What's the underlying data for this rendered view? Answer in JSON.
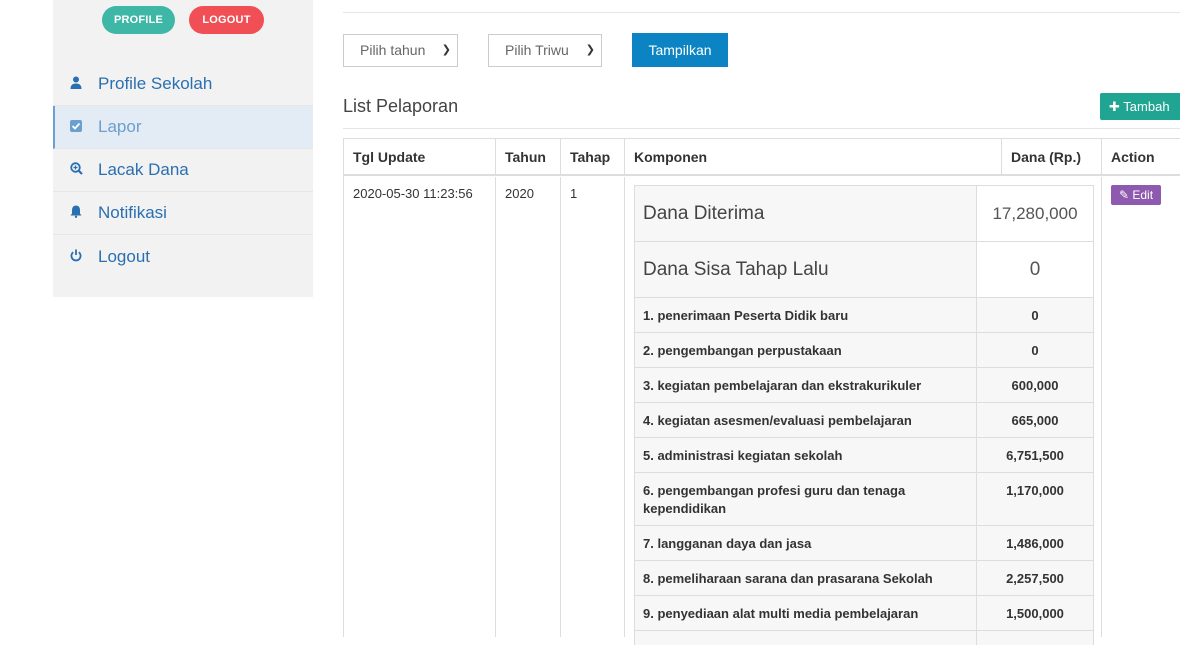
{
  "sidebar": {
    "profile_btn": "PROFILE",
    "logout_btn": "LOGOUT",
    "items": [
      {
        "label": "Profile Sekolah",
        "icon": "user-icon"
      },
      {
        "label": "Lapor",
        "icon": "check-square-icon"
      },
      {
        "label": "Lacak Dana",
        "icon": "search-plus-icon"
      },
      {
        "label": "Notifikasi",
        "icon": "bell-icon"
      },
      {
        "label": "Logout",
        "icon": "power-icon"
      }
    ]
  },
  "filters": {
    "year_select": "Pilih tahun",
    "quarter_select": "Pilih Triwu",
    "show_button": "Tampilkan"
  },
  "list": {
    "title": "List Pelaporan",
    "add_button": "Tambah"
  },
  "table": {
    "headers": [
      "Tgl Update",
      "Tahun",
      "Tahap",
      "Komponen",
      "Dana (Rp.)",
      "Action"
    ],
    "row": {
      "tgl_update": "2020-05-30 11:23:56",
      "tahun": "2020",
      "tahap": "1",
      "edit_button": "Edit",
      "komponen": [
        {
          "label": "Dana Diterima",
          "value": "17,280,000"
        },
        {
          "label": "Dana Sisa Tahap Lalu",
          "value": "0"
        },
        {
          "label": "1. penerimaan Peserta Didik baru",
          "value": "0"
        },
        {
          "label": "2. pengembangan perpustakaan",
          "value": "0"
        },
        {
          "label": "3. kegiatan pembelajaran dan ekstrakurikuler",
          "value": "600,000"
        },
        {
          "label": "4. kegiatan asesmen/evaluasi pembelajaran",
          "value": "665,000"
        },
        {
          "label": "5. administrasi kegiatan sekolah",
          "value": "6,751,500"
        },
        {
          "label": "6. pengembangan profesi guru dan tenaga kependidikan",
          "value": "1,170,000"
        },
        {
          "label": "7. langganan daya dan jasa",
          "value": "1,486,000"
        },
        {
          "label": "8. pemeliharaan sarana dan prasarana Sekolah",
          "value": "2,257,500"
        },
        {
          "label": "9. penyediaan alat multi media pembelajaran",
          "value": "1,500,000"
        }
      ]
    }
  },
  "colors": {
    "profile": "#3fb7a6",
    "logout": "#f05055",
    "primary": "#0c84c4",
    "add": "#1fa592",
    "edit": "#8e5ab0",
    "link": "#2a6fb0"
  }
}
